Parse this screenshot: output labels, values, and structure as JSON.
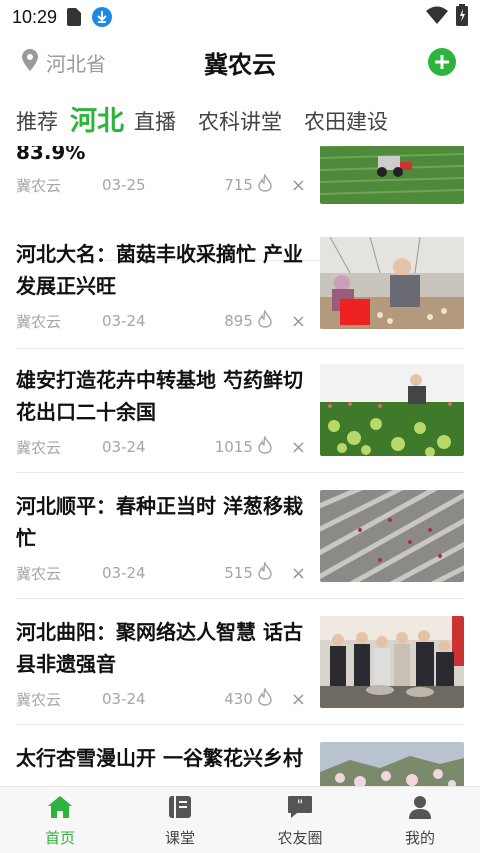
{
  "status_bar": {
    "time": "10:29"
  },
  "header": {
    "location": "河北省",
    "title": "冀农云"
  },
  "tabs": [
    {
      "label": "推荐",
      "active": false
    },
    {
      "label": "河北",
      "active": true
    },
    {
      "label": "直播",
      "active": false
    },
    {
      "label": "农科讲堂",
      "active": false
    },
    {
      "label": "农田建设",
      "active": false
    }
  ],
  "articles": [
    {
      "title": "83.9%",
      "source": "冀农云",
      "date": "03-25",
      "views": "715"
    },
    {
      "title": "河北大名：菌菇丰收采摘忙 产业发展正兴旺",
      "source": "冀农云",
      "date": "03-24",
      "views": "895"
    },
    {
      "title": "雄安打造花卉中转基地 芍药鲜切花出口二十余国",
      "source": "冀农云",
      "date": "03-24",
      "views": "1015"
    },
    {
      "title": "河北顺平：春种正当时 洋葱移栽忙",
      "source": "冀农云",
      "date": "03-24",
      "views": "515"
    },
    {
      "title": "河北曲阳：聚网络达人智慧 话古县非遗强音",
      "source": "冀农云",
      "date": "03-24",
      "views": "430"
    },
    {
      "title": "太行杏雪漫山开 一谷繁花兴乡村",
      "source": "",
      "date": "",
      "views": ""
    }
  ],
  "close_symbol": "×",
  "bottom_nav": [
    {
      "label": "首页",
      "icon": "home-icon",
      "active": true
    },
    {
      "label": "课堂",
      "icon": "book-icon",
      "active": false
    },
    {
      "label": "农友圈",
      "icon": "chat-quote-icon",
      "active": false
    },
    {
      "label": "我的",
      "icon": "user-icon",
      "active": false
    }
  ],
  "colors": {
    "accent": "#2db43c",
    "muted": "#a5a5a5"
  }
}
